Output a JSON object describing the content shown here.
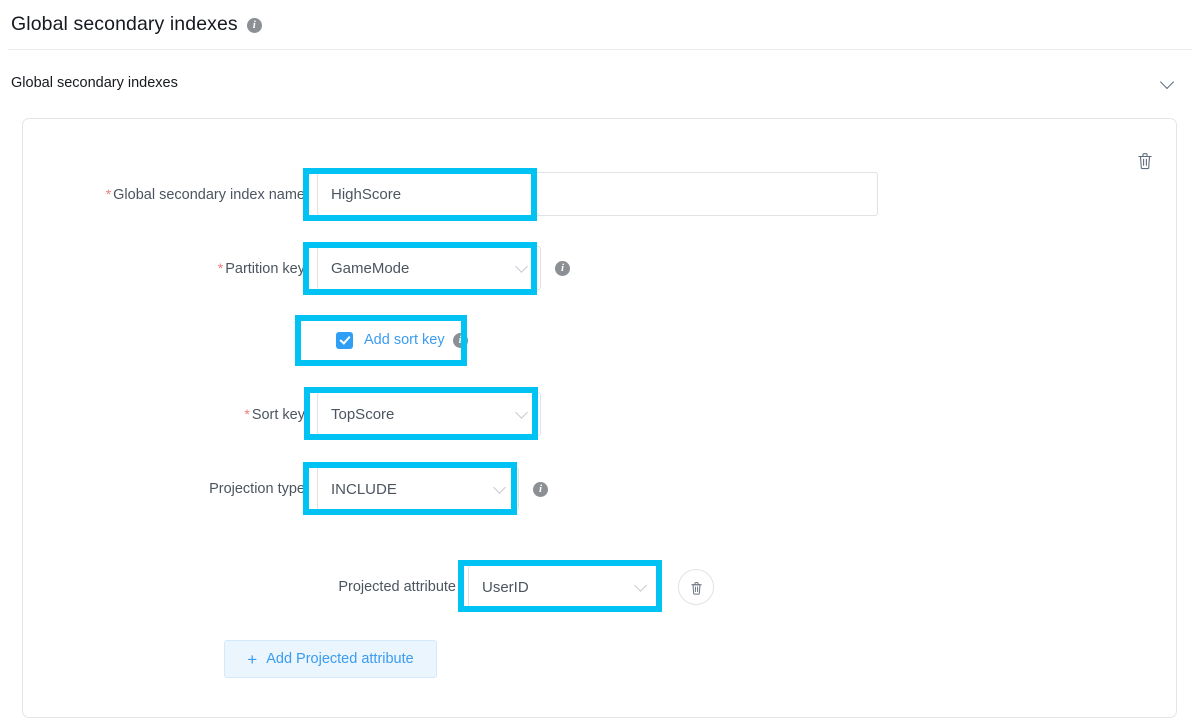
{
  "page": {
    "title": "Global secondary indexes",
    "title_info_icon": "info-icon"
  },
  "section": {
    "title": "Global secondary indexes",
    "collapse_icon": "chevron-down-icon"
  },
  "card": {
    "delete_icon": "trash-icon",
    "fields": {
      "index_name": {
        "label": "Global secondary index name",
        "required_marker": "*",
        "value": "HighScore",
        "placeholder": ""
      },
      "partition_key": {
        "label": "Partition key",
        "required_marker": "*",
        "value": "GameMode",
        "info_icon": "info-icon",
        "chevron_icon": "chevron-down-icon"
      },
      "add_sort_key": {
        "label": "Add sort key",
        "checked": true,
        "info_icon": "info-icon",
        "checkbox_icon": "checkbox-checked-icon"
      },
      "sort_key": {
        "label": "Sort key",
        "required_marker": "*",
        "value": "TopScore",
        "chevron_icon": "chevron-down-icon"
      },
      "projection_type": {
        "label": "Projection type",
        "value": "INCLUDE",
        "info_icon": "info-icon",
        "chevron_icon": "chevron-down-icon"
      },
      "projected_attribute": {
        "label": "Projected attribute",
        "value": "UserID",
        "chevron_icon": "chevron-down-icon",
        "delete_icon": "trash-icon"
      }
    },
    "add_projected_attribute": {
      "plus": "+",
      "label": "Add Projected attribute"
    }
  },
  "colors": {
    "highlight": "#00c2f3",
    "link": "#3b9cf0",
    "checkbox": "#2f9ff6",
    "required": "#f07a7a",
    "label_text": "#4c555f",
    "border": "#dfe3e6"
  }
}
